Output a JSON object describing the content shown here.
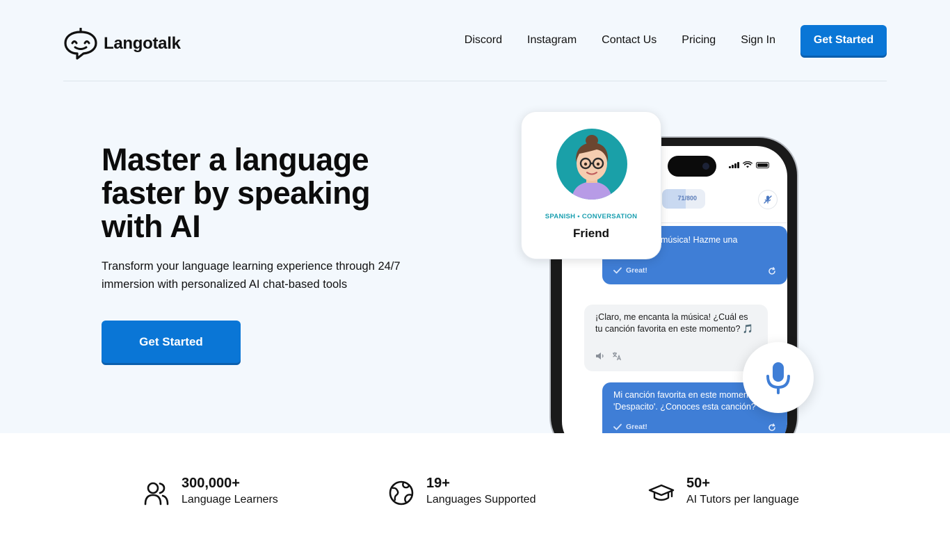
{
  "brand": {
    "name": "Langotalk"
  },
  "nav": {
    "links": [
      "Discord",
      "Instagram",
      "Contact Us",
      "Pricing",
      "Sign In"
    ],
    "cta": "Get Started"
  },
  "hero": {
    "headline": "Master a language faster by speaking with AI",
    "subline": "Transform your language learning experience through 24/7 immersion with personalized AI chat-based tools",
    "cta": "Get Started"
  },
  "friend_card": {
    "tag": "SPANISH • CONVERSATION",
    "name": "Friend"
  },
  "phone": {
    "progress_text": "71/800",
    "progress_fraction": 0.089,
    "messages": [
      {
        "role": "user",
        "text": "música! Hazme una",
        "feedback": "Great!"
      },
      {
        "role": "ai",
        "text": "¡Claro, me encanta la música! ¿Cuál es tu canción favorita en este momento? 🎵"
      },
      {
        "role": "user",
        "text_line1": "Mi canción favorita en este momen",
        "text_line2": "'Despacito'. ¿Conoces esta canción?",
        "feedback": "Great!"
      }
    ]
  },
  "stats": [
    {
      "number": "300,000+",
      "label": "Language Learners",
      "icon": "users-icon"
    },
    {
      "number": "19+",
      "label": "Languages Supported",
      "icon": "globe-icon"
    },
    {
      "number": "50+",
      "label": "AI Tutors per language",
      "icon": "graduation-cap-icon"
    }
  ],
  "colors": {
    "primary": "#0a76d6",
    "hero_bg": "#f3f8fd",
    "bubble_user": "#3f7ed6",
    "tag": "#1a9fb0"
  }
}
